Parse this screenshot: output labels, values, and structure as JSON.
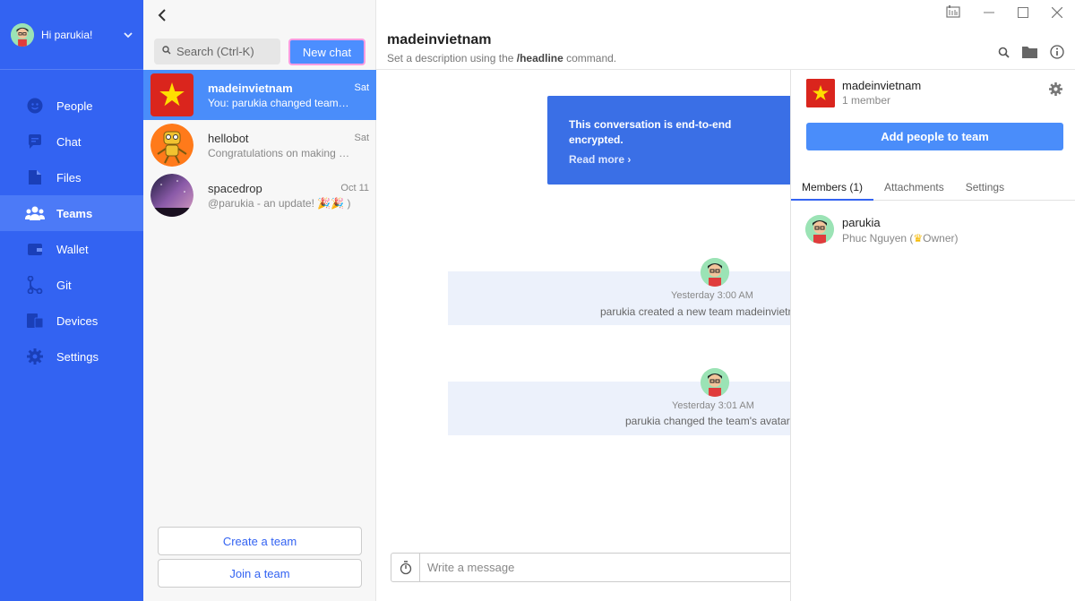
{
  "nav": {
    "greeting": "Hi parukia!",
    "items": [
      {
        "label": "People",
        "icon": "people-icon"
      },
      {
        "label": "Chat",
        "icon": "chat-icon"
      },
      {
        "label": "Files",
        "icon": "files-icon"
      },
      {
        "label": "Teams",
        "icon": "teams-icon",
        "active": true
      },
      {
        "label": "Wallet",
        "icon": "wallet-icon"
      },
      {
        "label": "Git",
        "icon": "git-icon"
      },
      {
        "label": "Devices",
        "icon": "devices-icon"
      },
      {
        "label": "Settings",
        "icon": "gear-icon"
      }
    ]
  },
  "conversations": {
    "search_placeholder": "Search (Ctrl-K)",
    "new_chat_label": "New chat",
    "items": [
      {
        "name": "madeinvietnam",
        "snippet": "You: parukia changed team avatar",
        "date": "Sat"
      },
      {
        "name": "hellobot",
        "snippet": "Congratulations on making your first team",
        "date": "Sat"
      },
      {
        "name": "spacedrop",
        "snippet": "@parukia - an update! 🎉🎉 )",
        "date": "Oct 11"
      }
    ],
    "create_team_label": "Create a team",
    "join_team_label": "Join a team"
  },
  "chat": {
    "title": "madeinvietnam",
    "description_prefix": "Set a description using the ",
    "description_command": "/headline",
    "description_suffix": " command.",
    "encryption_text": "This conversation is end-to-end encrypted.",
    "read_more_label": "Read more ›",
    "system_messages": [
      {
        "time": "Yesterday 3:00 AM",
        "text": "parukia created a new team madeinvietnam."
      },
      {
        "time": "Yesterday 3:01 AM",
        "text": "parukia changed the team's avatar."
      }
    ],
    "composer_placeholder": "Write a message"
  },
  "info_panel": {
    "team_name": "madeinvietnam",
    "member_count": "1 member",
    "add_people_label": "Add people to team",
    "tabs": [
      "Members (1)",
      "Attachments",
      "Settings"
    ],
    "members": [
      {
        "username": "parukia",
        "full_name": "Phuc Nguyen",
        "role": "Owner"
      }
    ]
  },
  "colors": {
    "nav_bg": "#3363f2",
    "selected_row": "#4a8dfa",
    "encryption_box": "#3a6fe6",
    "vietnam_red": "#da251d",
    "vietnam_star": "#ffde00"
  }
}
